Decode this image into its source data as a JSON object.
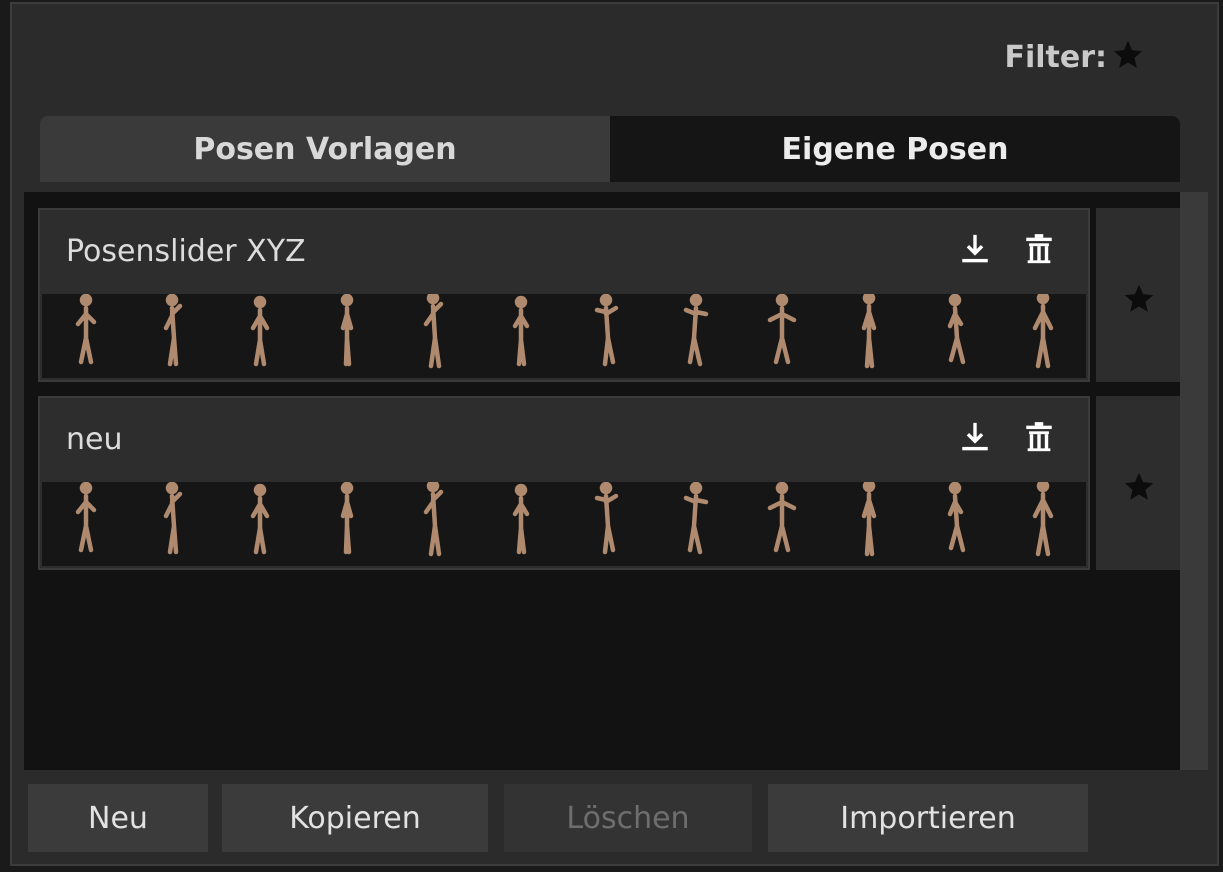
{
  "filter": {
    "label": "Filter:"
  },
  "tabs": [
    {
      "label": "Posen Vorlagen",
      "active": true
    },
    {
      "label": "Eigene Posen",
      "active": false
    }
  ],
  "pose_sets": [
    {
      "title": "Posenslider XYZ",
      "pose_count": 12,
      "favorite": false
    },
    {
      "title": "neu",
      "pose_count": 12,
      "favorite": false
    }
  ],
  "footer": {
    "new_label": "Neu",
    "copy_label": "Kopieren",
    "delete_label": "Löschen",
    "delete_disabled": true,
    "import_label": "Importieren"
  },
  "colors": {
    "figure": "#b08a6e",
    "star": "#0c0c0c",
    "icon": "#ffffff"
  },
  "icons": [
    "star-icon",
    "download-icon",
    "trash-icon",
    "pose-figure-icon"
  ]
}
